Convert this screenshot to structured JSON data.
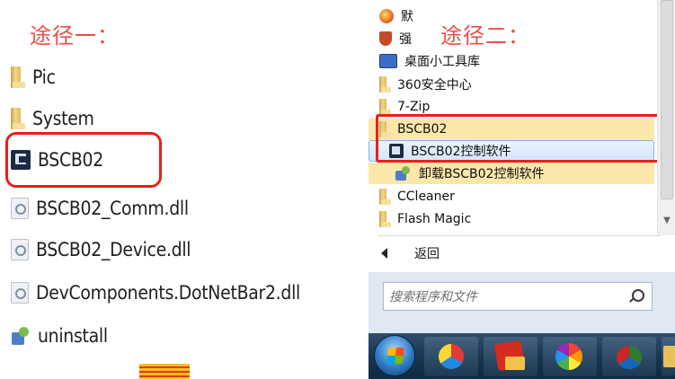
{
  "path_one": {
    "title": "途径一：",
    "items": [
      {
        "label": "Pic",
        "icon": "folder-icon"
      },
      {
        "label": "System",
        "icon": "folder-icon"
      },
      {
        "label": "BSCB02",
        "icon": "app-icon"
      },
      {
        "label": "BSCB02_Comm.dll",
        "icon": "dll-file-icon"
      },
      {
        "label": "BSCB02_Device.dll",
        "icon": "dll-file-icon"
      },
      {
        "label": "DevComponents.DotNetBar2.dll",
        "icon": "dll-file-icon"
      },
      {
        "label": "uninstall",
        "icon": "uninstall-icon"
      }
    ],
    "highlight_color": "#e8201a"
  },
  "path_two": {
    "title": "途径二：",
    "menu_items": [
      {
        "label": "默",
        "icon": "globe-icon"
      },
      {
        "label": "强",
        "icon": "shield-icon"
      },
      {
        "label": "桌面小工具库",
        "icon": "gadget-icon"
      },
      {
        "label": "360安全中心",
        "icon": "folder-icon"
      },
      {
        "label": "7-Zip",
        "icon": "folder-icon"
      },
      {
        "label": "BSCB02",
        "icon": "folder-icon"
      },
      {
        "label": "BSCB02控制软件",
        "icon": "app-icon"
      },
      {
        "label": "卸载BSCB02控制软件",
        "icon": "uninstall-icon"
      },
      {
        "label": "CCleaner",
        "icon": "folder-icon"
      },
      {
        "label": "Flash Magic",
        "icon": "folder-icon"
      }
    ],
    "back_label": "返回",
    "search_placeholder": "搜索程序和文件",
    "selected_folder_color": "#fbe7a9",
    "highlight_color": "#e8201a"
  }
}
